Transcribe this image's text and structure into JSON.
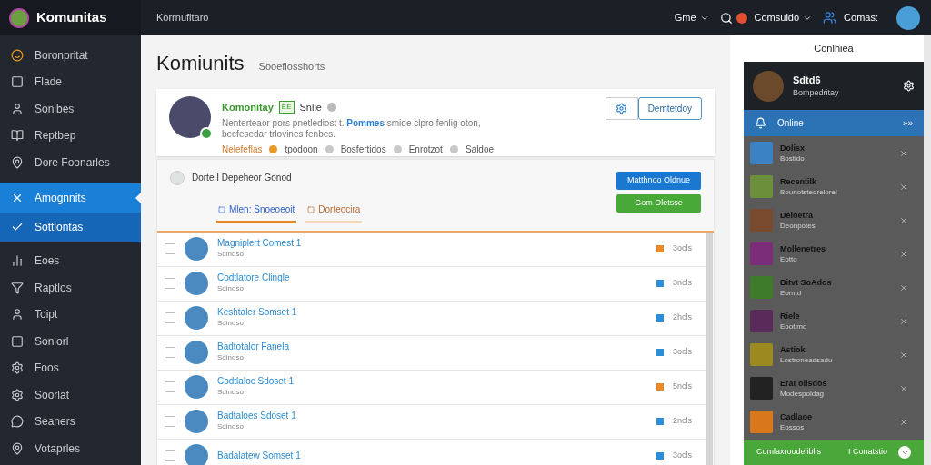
{
  "topbar": {
    "logo": "Komunitas",
    "crumb": "Korrnufitaro",
    "menus": [
      {
        "label": "Gme"
      },
      {
        "label": "Comsuldo"
      }
    ],
    "account": "Comas:"
  },
  "sidebar": {
    "items": [
      {
        "label": "Boronpritat",
        "selected": false
      },
      {
        "label": "Flade",
        "selected": false
      },
      {
        "label": "Sonlbes",
        "selected": false
      },
      {
        "label": "Reptbep",
        "selected": false
      },
      {
        "label": "Dore Foonarles",
        "selected": false
      },
      {
        "label": "Amognnits",
        "selected": true
      },
      {
        "label": "Sottlontas",
        "selected": true
      },
      {
        "label": "Eoes",
        "selected": false
      },
      {
        "label": "Raptlos",
        "selected": false
      },
      {
        "label": "Toipt",
        "selected": false
      },
      {
        "label": "Soniorl",
        "selected": false
      },
      {
        "label": "Foos",
        "selected": false
      },
      {
        "label": "Soorlat",
        "selected": false
      },
      {
        "label": "Seaners",
        "selected": false
      },
      {
        "label": "Votaprles",
        "selected": false
      }
    ]
  },
  "page": {
    "title": "Komiunits",
    "subtitle": "Sooefiosshorts"
  },
  "profile": {
    "name": "Komonitay",
    "tag": "EE",
    "status": "Snlie",
    "description": "Nenterteaor pors pnetlediost t. **Pommes** smide clpro fenlig oton, becfesedar trlovines fenbes.",
    "meta": [
      "Nelefeflas",
      "tpodoon",
      "Bosfertidos",
      "Enrotzot",
      "Saldoe"
    ],
    "action": "Demtetdoy"
  },
  "section": {
    "heading": "Dorte I Depeheor Gonod",
    "buttons": [
      "Matthnoo Oldnue",
      "Gom Oletsse"
    ],
    "tabs": [
      {
        "label": "Mlen: Snoeoeoit",
        "selected": true
      },
      {
        "label": "Dorteocira",
        "selected": false
      }
    ]
  },
  "members": [
    {
      "name": "Magniplert Comest 1",
      "sub": "Sdindso",
      "count": "3ocls",
      "color": "#e8892b",
      "checked": false
    },
    {
      "name": "Codtlatore Clingle",
      "sub": "Sdindso",
      "count": "3ncls",
      "color": "#2a8fd6",
      "checked": false
    },
    {
      "name": "Keshtaler Somset 1",
      "sub": "Sdindso",
      "count": "2hcls",
      "color": "#2a8fd6",
      "checked": false
    },
    {
      "name": "Badtotalor Fanela",
      "sub": "Sdindso",
      "count": "3ocls",
      "color": "#2a8fd6",
      "checked": false
    },
    {
      "name": "Codtlaloc Sdoset 1",
      "sub": "Sdindso",
      "count": "5ncls",
      "color": "#e8892b",
      "checked": false
    },
    {
      "name": "Badtaloes Sdoset 1",
      "sub": "Sdindso",
      "count": "2ncls",
      "color": "#2a8fd6",
      "checked": false
    },
    {
      "name": "Badalatew Somset 1",
      "count": "3ocls",
      "color": "#2a8fd6",
      "checked": false
    }
  ],
  "panel": {
    "title": "Conlhiea",
    "user": {
      "name": "Sdtd6",
      "sub": "Bompedritay"
    },
    "online": "Online",
    "online_more": "»»",
    "friends": [
      {
        "name": "Dolisx",
        "sub": "Bostido"
      },
      {
        "name": "Recentilk",
        "sub": "Bounotstedrelorel"
      },
      {
        "name": "Deloetra",
        "sub": "Deonpotes"
      },
      {
        "name": "Mollenetres",
        "sub": "Eotto"
      },
      {
        "name": "Bitvt SoAdos",
        "sub": "Eomtd"
      },
      {
        "name": "Riele",
        "sub": "Eootimd"
      },
      {
        "name": "Astiok",
        "sub": "Lostroneadsadu"
      },
      {
        "name": "Erat olisdos",
        "sub": "Modespoldag"
      },
      {
        "name": "Cadlaoe",
        "sub": "Eossos"
      }
    ],
    "footer": "Comlaxroodeliblis",
    "footer_action": "I Conatstio"
  }
}
